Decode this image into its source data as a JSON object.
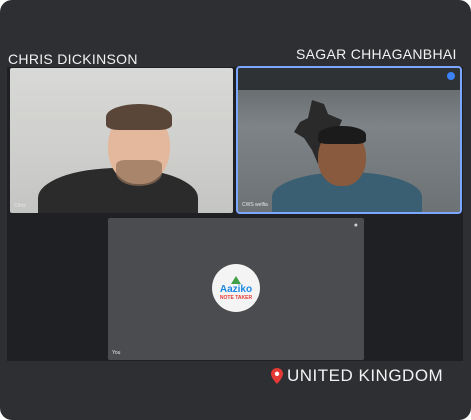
{
  "participants": {
    "left": {
      "name": "CHRIS DICKINSON",
      "caption": "Chris"
    },
    "right": {
      "name": "SAGAR  CHHAGANBHAI",
      "caption": "CWS welfia"
    },
    "bottom": {
      "caption": "You"
    }
  },
  "logo": {
    "brand": "Aaziko",
    "sub": "NOTE TAKER"
  },
  "location": {
    "text": "UNITED KINGDOM"
  },
  "colors": {
    "frame": "#2e2f32",
    "active_outline": "#7aa7ff",
    "pin": "#e53935"
  },
  "icons": [
    "map-pin-icon",
    "pin-icon",
    "mic-icon"
  ]
}
